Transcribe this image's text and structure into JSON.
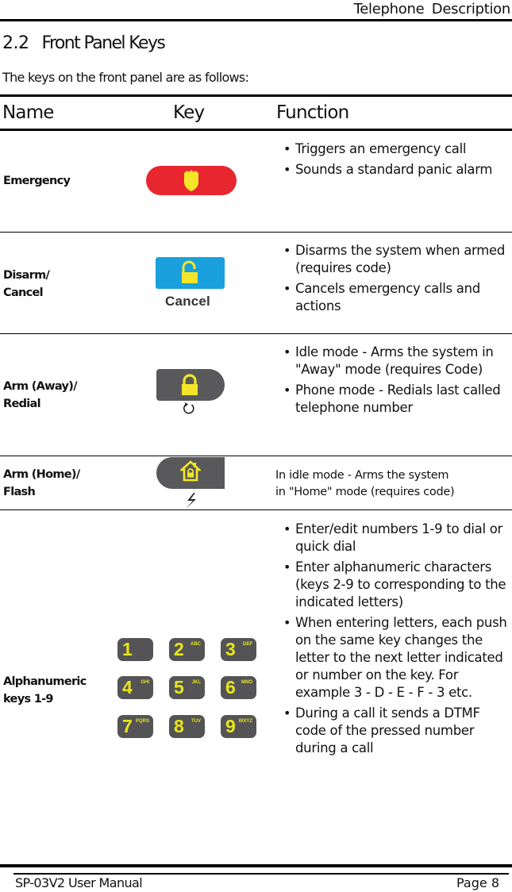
{
  "header": {
    "running_title": "Telephone Description"
  },
  "section": {
    "number": "2.2",
    "title": "Front Panel Keys",
    "intro": "The keys on the front panel are as follows:"
  },
  "table": {
    "columns": [
      "Name",
      "Key",
      "Function"
    ],
    "rows": [
      {
        "name": "Emergency",
        "key_icon": "emergency-shield-key",
        "functions": [
          "Triggers an emergency call",
          "Sounds a standard panic alarm"
        ]
      },
      {
        "name": "Disarm/ Cancel",
        "name_lines": [
          "Disarm/",
          "Cancel"
        ],
        "key_icon": "unlock-key",
        "key_label": "Cancel",
        "functions": [
          "Disarms the system when armed (requires code)",
          "Cancels emergency calls and actions"
        ]
      },
      {
        "name": "Arm (Away)/ Redial",
        "name_lines": [
          "Arm (Away)/",
          "Redial"
        ],
        "key_icon": "lock-redial-key",
        "functions": [
          "Idle mode - Arms the system in \"Away\" mode (requires Code)",
          "Phone mode - Redials last called telephone number"
        ]
      },
      {
        "name": "Arm (Home)/ Flash",
        "name_lines": [
          "Arm (Home)/",
          "Flash"
        ],
        "key_icon": "home-flash-key",
        "function_text_lines": [
          "In idle mode - Arms the system",
          "in \"Home\" mode (requires code)"
        ]
      },
      {
        "name": "Alphanumeric keys 1-9",
        "name_lines": [
          "Alphanumeric",
          "keys 1-9"
        ],
        "key_icon": "numeric-keypad",
        "keypad": [
          {
            "num": "1",
            "letters": ""
          },
          {
            "num": "2",
            "letters": "ABC"
          },
          {
            "num": "3",
            "letters": "DEF"
          },
          {
            "num": "4",
            "letters": "GHI"
          },
          {
            "num": "5",
            "letters": "JKL"
          },
          {
            "num": "6",
            "letters": "MNO"
          },
          {
            "num": "7",
            "letters": "PQRS"
          },
          {
            "num": "8",
            "letters": "TUV"
          },
          {
            "num": "9",
            "letters": "WXYZ"
          }
        ],
        "functions": [
          "Enter/edit numbers 1-9 to dial or quick dial",
          "Enter alphanumeric characters (keys 2-9 to corresponding to the indicated letters)",
          "When entering letters, each push on the same key changes the letter to the next letter indicated or number on the key. For example 3 - D - E - F - 3 etc.",
          "During a call it sends a DTMF code of the pressed number during a call"
        ]
      }
    ]
  },
  "colors": {
    "emergency_red": "#e8262f",
    "cancel_blue": "#1aa0dc",
    "key_gray": "#59595b",
    "icon_yellow": "#f3e629"
  },
  "footer": {
    "manual": "SP-03V2 User Manual",
    "page": "Page 8"
  }
}
